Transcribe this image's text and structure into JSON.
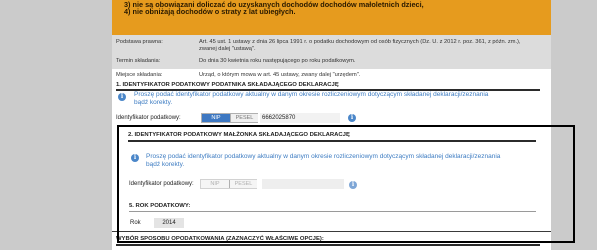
{
  "notice": {
    "line1": "3) nie są obowiązani doliczać do uzyskanych dochodów dochodów małoletnich dzieci,",
    "line2": "4) nie obniżają dochodów o straty z lat ubiegłych."
  },
  "info": {
    "basis_label": "Podstawa prawna:",
    "basis_value_1": "Art. 45 ust. 1 ustawy z dnia 26 lipca 1991 r. o podatku dochodowym od osób fizycznych (Dz. U. z 2012 r. poz. 361, z późn. zm.),",
    "basis_value_2": "zwanej dalej \"ustawą\".",
    "deadline_label": "Termin składania:",
    "deadline_value": "Do dnia 30 kwietnia roku następującego po roku podatkowym.",
    "place_label": "Miejsce składania:",
    "place_value": "Urząd, o którym mowa w art. 45 ustawy, zwany dalej \"urzędem\"."
  },
  "section1": {
    "title": "1. IDENTYFIKATOR PODATKOWY PODATNIKA SKŁADAJĄCEGO DEKLARACJĘ",
    "hint_line1": "Proszę podać identyfikator podatkowy aktualny w danym okresie rozliczeniowym dotyczącym składanej deklaracji/zeznania",
    "hint_line2": "bądź korekty.",
    "field_label": "Identyfikator podatkowy:",
    "opt_nip": "NIP",
    "opt_pesel": "PESEL",
    "value": "6662025870"
  },
  "section2": {
    "title": "2. IDENTYFIKATOR PODATKOWY MAŁŻONKA SKŁADAJĄCEGO DEKLARACJĘ",
    "hint_line1": "Proszę podać identyfikator podatkowy aktualny w danym okresie rozliczeniowym dotyczącym składanej deklaracji/zeznania",
    "hint_line2": "bądź korekty.",
    "field_label": "Identyfikator podatkowy:",
    "opt_nip": "NIP",
    "opt_pesel": "PESEL",
    "value": ""
  },
  "section5": {
    "title": "5. ROK PODATKOWY:",
    "year_label": "Rok",
    "year_value": "2014"
  },
  "section_next": {
    "title": "WYBÓR SPOSOBU OPODATKOWANIA (ZAZNACZYĆ WŁAŚCIWE OPCJE):"
  },
  "icons": {
    "info": "i"
  }
}
